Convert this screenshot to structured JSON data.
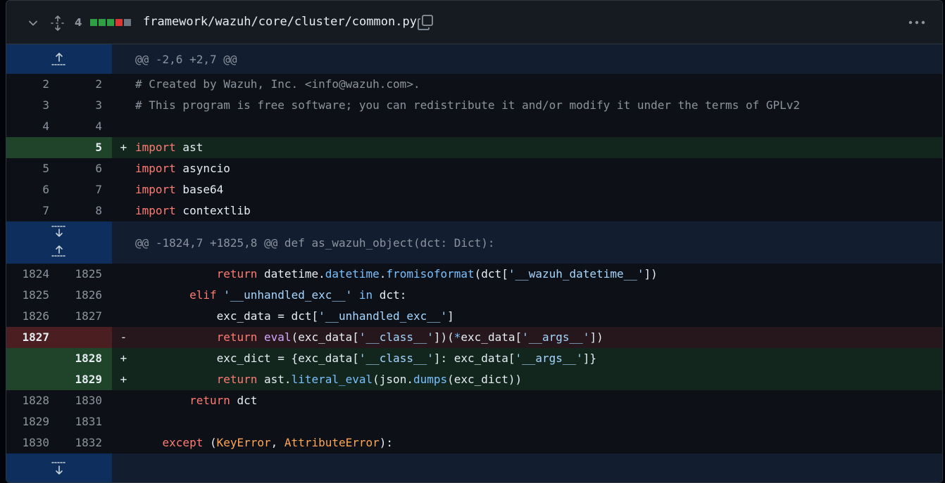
{
  "file": {
    "changes_count": "4",
    "path": "framework/wazuh/core/cluster/common.py",
    "diffstat_colors": [
      "#2ea043",
      "#2ea043",
      "#2ea043",
      "#da3633",
      "#6e7681"
    ]
  },
  "hunks": [
    {
      "header": "@@ -2,6 +2,7 @@"
    },
    {
      "header": "@@ -1824,7 +1825,8 @@ def as_wazuh_object(dct: Dict):"
    }
  ],
  "lines": [
    {
      "old": "2",
      "new": "2",
      "sign": "",
      "tokens": [
        [
          "cm",
          "# Created by Wazuh, Inc. <info@wazuh.com>."
        ]
      ]
    },
    {
      "old": "3",
      "new": "3",
      "sign": "",
      "tokens": [
        [
          "cm",
          "# This program is free software; you can redistribute it and/or modify it under the terms of GPLv2"
        ]
      ]
    },
    {
      "old": "4",
      "new": "4",
      "sign": "",
      "tokens": []
    },
    {
      "old": "",
      "new": "5",
      "sign": "+",
      "tokens": [
        [
          "kw",
          "import"
        ],
        [
          "",
          " ast"
        ]
      ]
    },
    {
      "old": "5",
      "new": "6",
      "sign": "",
      "tokens": [
        [
          "kw",
          "import"
        ],
        [
          "",
          " asyncio"
        ]
      ]
    },
    {
      "old": "6",
      "new": "7",
      "sign": "",
      "tokens": [
        [
          "kw",
          "import"
        ],
        [
          "",
          " base64"
        ]
      ]
    },
    {
      "old": "7",
      "new": "8",
      "sign": "",
      "tokens": [
        [
          "kw",
          "import"
        ],
        [
          "",
          " contextlib"
        ]
      ]
    },
    {
      "old": "1824",
      "new": "1825",
      "sign": "",
      "tokens": [
        [
          "",
          "            "
        ],
        [
          "kw",
          "return"
        ],
        [
          "",
          " datetime."
        ],
        [
          "attr",
          "datetime"
        ],
        [
          "",
          "."
        ],
        [
          "attr",
          "fromisoformat"
        ],
        [
          "",
          "(dct["
        ],
        [
          "str",
          "'__wazuh_datetime__'"
        ],
        [
          "",
          "])"
        ]
      ]
    },
    {
      "old": "1825",
      "new": "1826",
      "sign": "",
      "tokens": [
        [
          "",
          "        "
        ],
        [
          "kw",
          "elif"
        ],
        [
          "",
          " "
        ],
        [
          "str",
          "'__unhandled_exc__'"
        ],
        [
          "",
          " "
        ],
        [
          "attr",
          "in"
        ],
        [
          "",
          " dct:"
        ]
      ]
    },
    {
      "old": "1826",
      "new": "1827",
      "sign": "",
      "tokens": [
        [
          "",
          "            exc_data = dct["
        ],
        [
          "str",
          "'__unhandled_exc__'"
        ],
        [
          "",
          "]"
        ]
      ]
    },
    {
      "old": "1827",
      "new": "",
      "sign": "-",
      "tokens": [
        [
          "",
          "            "
        ],
        [
          "kw",
          "return"
        ],
        [
          "",
          " "
        ],
        [
          "fn",
          "eval"
        ],
        [
          "",
          "(exc_data["
        ],
        [
          "str",
          "'__class__'"
        ],
        [
          "",
          "])("
        ],
        [
          "attr",
          "*"
        ],
        [
          "",
          "exc_data["
        ],
        [
          "str",
          "'__args__'"
        ],
        [
          "",
          "])"
        ]
      ]
    },
    {
      "old": "",
      "new": "1828",
      "sign": "+",
      "tokens": [
        [
          "",
          "            exc_dict = {exc_data["
        ],
        [
          "str",
          "'__class__'"
        ],
        [
          "",
          "]: exc_data["
        ],
        [
          "str",
          "'__args__'"
        ],
        [
          "",
          "]}"
        ]
      ]
    },
    {
      "old": "",
      "new": "1829",
      "sign": "+",
      "tokens": [
        [
          "",
          "            "
        ],
        [
          "kw",
          "return"
        ],
        [
          "",
          " ast."
        ],
        [
          "attr",
          "literal_eval"
        ],
        [
          "",
          "(json."
        ],
        [
          "attr",
          "dumps"
        ],
        [
          "",
          "(exc_dict))"
        ]
      ]
    },
    {
      "old": "1828",
      "new": "1830",
      "sign": "",
      "tokens": [
        [
          "",
          "        "
        ],
        [
          "kw",
          "return"
        ],
        [
          "",
          " dct"
        ]
      ]
    },
    {
      "old": "1829",
      "new": "1831",
      "sign": "",
      "tokens": []
    },
    {
      "old": "1830",
      "new": "1832",
      "sign": "",
      "tokens": [
        [
          "",
          "    "
        ],
        [
          "kw",
          "except"
        ],
        [
          "",
          " ("
        ],
        [
          "cls",
          "KeyError"
        ],
        [
          "",
          ", "
        ],
        [
          "cls",
          "AttributeError"
        ],
        [
          "",
          "):"
        ]
      ]
    }
  ]
}
